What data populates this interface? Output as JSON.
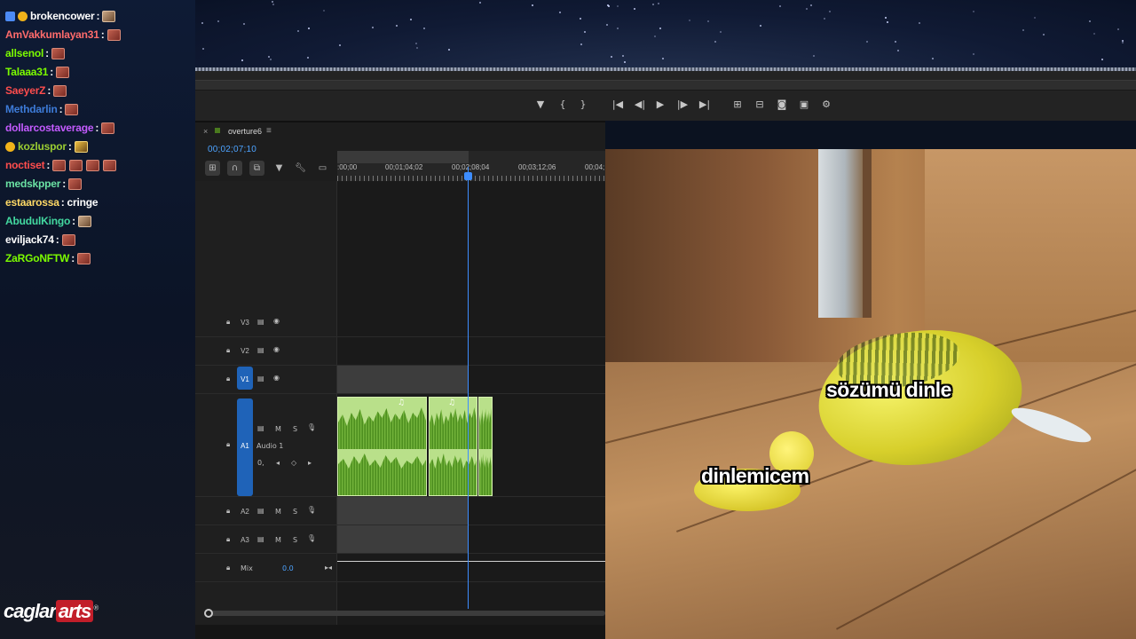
{
  "chat": {
    "messages": [
      {
        "user": "brokencower",
        "color": "#ffffff",
        "badges": [
          "prime",
          "sub"
        ],
        "emotes": [
          "face"
        ],
        "text": ""
      },
      {
        "user": "AmVakkumlayan31",
        "color": "#ff6b6b",
        "emotes": [
          "emote"
        ],
        "text": ""
      },
      {
        "user": "allsenol",
        "color": "#7cfc00",
        "emotes": [
          "emote"
        ],
        "text": ""
      },
      {
        "user": "Talaaa31",
        "color": "#7cfc00",
        "emotes": [
          "emote"
        ],
        "text": ""
      },
      {
        "user": "SaeyerZ",
        "color": "#ff4d4d",
        "emotes": [
          "emote"
        ],
        "text": ""
      },
      {
        "user": "Methdarlin",
        "color": "#3d7bd8",
        "emotes": [
          "emote"
        ],
        "text": ""
      },
      {
        "user": "dollarcostaverage",
        "color": "#c45bff",
        "emotes": [
          "emote"
        ],
        "text": ""
      },
      {
        "user": "kozluspor",
        "color": "#9acd32",
        "badges": [
          "sub"
        ],
        "emotes": [
          "mustache"
        ],
        "text": ""
      },
      {
        "user": "noctiset",
        "color": "#ff4d4d",
        "emotes": [
          "emote",
          "emote",
          "emote",
          "emote"
        ],
        "text": ""
      },
      {
        "user": "medskpper",
        "color": "#6be3a4",
        "emotes": [
          "emote"
        ],
        "text": ""
      },
      {
        "user": "estaarossa",
        "color": "#ffd966",
        "emotes": [],
        "text": "cringe"
      },
      {
        "user": "AbudulKingo",
        "color": "#43d9a0",
        "emotes": [
          "face"
        ],
        "text": ""
      },
      {
        "user": "eviljack74",
        "color": "#ffffff",
        "emotes": [
          "emote"
        ],
        "text": ""
      },
      {
        "user": "ZaRGoNFTW",
        "color": "#7cfc00",
        "emotes": [
          "emote"
        ],
        "text": ""
      }
    ]
  },
  "logo": {
    "text_a": "caglar",
    "text_b": "arts"
  },
  "sequence": {
    "name": "overture6",
    "timecode": "00;02;07;10"
  },
  "ruler": {
    "labels": [
      ":00;00",
      "00;01;04;02",
      "00;02;08;04",
      "00;03;12;06",
      "00;04;"
    ]
  },
  "tracks": {
    "video": [
      "V3",
      "V2",
      "V1"
    ],
    "audio": [
      {
        "id": "A1",
        "name": "Audio 1"
      },
      {
        "id": "A2"
      },
      {
        "id": "A3"
      }
    ],
    "mix": {
      "label": "Mix",
      "value": "0.0"
    },
    "m_label": "M",
    "s_label": "S",
    "zero_label": "0,"
  },
  "video_overlay": {
    "subtitle_1": "sözümü dinle",
    "subtitle_2": "dinlemicem"
  },
  "colors": {
    "accent": "#3d8dff",
    "clip": "#b9e08a",
    "track_tab": "#1f63b8"
  }
}
